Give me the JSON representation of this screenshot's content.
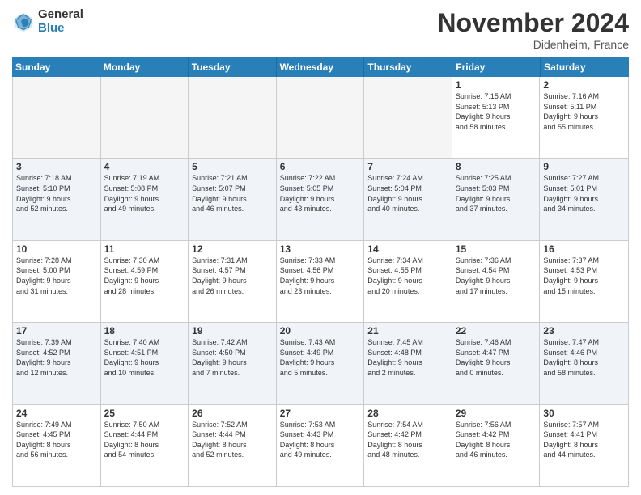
{
  "logo": {
    "general": "General",
    "blue": "Blue"
  },
  "title": "November 2024",
  "location": "Didenheim, France",
  "header_days": [
    "Sunday",
    "Monday",
    "Tuesday",
    "Wednesday",
    "Thursday",
    "Friday",
    "Saturday"
  ],
  "rows": [
    {
      "alt": false,
      "cells": [
        {
          "day": "",
          "detail": "",
          "empty": true
        },
        {
          "day": "",
          "detail": "",
          "empty": true
        },
        {
          "day": "",
          "detail": "",
          "empty": true
        },
        {
          "day": "",
          "detail": "",
          "empty": true
        },
        {
          "day": "",
          "detail": "",
          "empty": true
        },
        {
          "day": "1",
          "detail": "Sunrise: 7:15 AM\nSunset: 5:13 PM\nDaylight: 9 hours\nand 58 minutes."
        },
        {
          "day": "2",
          "detail": "Sunrise: 7:16 AM\nSunset: 5:11 PM\nDaylight: 9 hours\nand 55 minutes."
        }
      ]
    },
    {
      "alt": true,
      "cells": [
        {
          "day": "3",
          "detail": "Sunrise: 7:18 AM\nSunset: 5:10 PM\nDaylight: 9 hours\nand 52 minutes."
        },
        {
          "day": "4",
          "detail": "Sunrise: 7:19 AM\nSunset: 5:08 PM\nDaylight: 9 hours\nand 49 minutes."
        },
        {
          "day": "5",
          "detail": "Sunrise: 7:21 AM\nSunset: 5:07 PM\nDaylight: 9 hours\nand 46 minutes."
        },
        {
          "day": "6",
          "detail": "Sunrise: 7:22 AM\nSunset: 5:05 PM\nDaylight: 9 hours\nand 43 minutes."
        },
        {
          "day": "7",
          "detail": "Sunrise: 7:24 AM\nSunset: 5:04 PM\nDaylight: 9 hours\nand 40 minutes."
        },
        {
          "day": "8",
          "detail": "Sunrise: 7:25 AM\nSunset: 5:03 PM\nDaylight: 9 hours\nand 37 minutes."
        },
        {
          "day": "9",
          "detail": "Sunrise: 7:27 AM\nSunset: 5:01 PM\nDaylight: 9 hours\nand 34 minutes."
        }
      ]
    },
    {
      "alt": false,
      "cells": [
        {
          "day": "10",
          "detail": "Sunrise: 7:28 AM\nSunset: 5:00 PM\nDaylight: 9 hours\nand 31 minutes."
        },
        {
          "day": "11",
          "detail": "Sunrise: 7:30 AM\nSunset: 4:59 PM\nDaylight: 9 hours\nand 28 minutes."
        },
        {
          "day": "12",
          "detail": "Sunrise: 7:31 AM\nSunset: 4:57 PM\nDaylight: 9 hours\nand 26 minutes."
        },
        {
          "day": "13",
          "detail": "Sunrise: 7:33 AM\nSunset: 4:56 PM\nDaylight: 9 hours\nand 23 minutes."
        },
        {
          "day": "14",
          "detail": "Sunrise: 7:34 AM\nSunset: 4:55 PM\nDaylight: 9 hours\nand 20 minutes."
        },
        {
          "day": "15",
          "detail": "Sunrise: 7:36 AM\nSunset: 4:54 PM\nDaylight: 9 hours\nand 17 minutes."
        },
        {
          "day": "16",
          "detail": "Sunrise: 7:37 AM\nSunset: 4:53 PM\nDaylight: 9 hours\nand 15 minutes."
        }
      ]
    },
    {
      "alt": true,
      "cells": [
        {
          "day": "17",
          "detail": "Sunrise: 7:39 AM\nSunset: 4:52 PM\nDaylight: 9 hours\nand 12 minutes."
        },
        {
          "day": "18",
          "detail": "Sunrise: 7:40 AM\nSunset: 4:51 PM\nDaylight: 9 hours\nand 10 minutes."
        },
        {
          "day": "19",
          "detail": "Sunrise: 7:42 AM\nSunset: 4:50 PM\nDaylight: 9 hours\nand 7 minutes."
        },
        {
          "day": "20",
          "detail": "Sunrise: 7:43 AM\nSunset: 4:49 PM\nDaylight: 9 hours\nand 5 minutes."
        },
        {
          "day": "21",
          "detail": "Sunrise: 7:45 AM\nSunset: 4:48 PM\nDaylight: 9 hours\nand 2 minutes."
        },
        {
          "day": "22",
          "detail": "Sunrise: 7:46 AM\nSunset: 4:47 PM\nDaylight: 9 hours\nand 0 minutes."
        },
        {
          "day": "23",
          "detail": "Sunrise: 7:47 AM\nSunset: 4:46 PM\nDaylight: 8 hours\nand 58 minutes."
        }
      ]
    },
    {
      "alt": false,
      "cells": [
        {
          "day": "24",
          "detail": "Sunrise: 7:49 AM\nSunset: 4:45 PM\nDaylight: 8 hours\nand 56 minutes."
        },
        {
          "day": "25",
          "detail": "Sunrise: 7:50 AM\nSunset: 4:44 PM\nDaylight: 8 hours\nand 54 minutes."
        },
        {
          "day": "26",
          "detail": "Sunrise: 7:52 AM\nSunset: 4:44 PM\nDaylight: 8 hours\nand 52 minutes."
        },
        {
          "day": "27",
          "detail": "Sunrise: 7:53 AM\nSunset: 4:43 PM\nDaylight: 8 hours\nand 49 minutes."
        },
        {
          "day": "28",
          "detail": "Sunrise: 7:54 AM\nSunset: 4:42 PM\nDaylight: 8 hours\nand 48 minutes."
        },
        {
          "day": "29",
          "detail": "Sunrise: 7:56 AM\nSunset: 4:42 PM\nDaylight: 8 hours\nand 46 minutes."
        },
        {
          "day": "30",
          "detail": "Sunrise: 7:57 AM\nSunset: 4:41 PM\nDaylight: 8 hours\nand 44 minutes."
        }
      ]
    }
  ]
}
